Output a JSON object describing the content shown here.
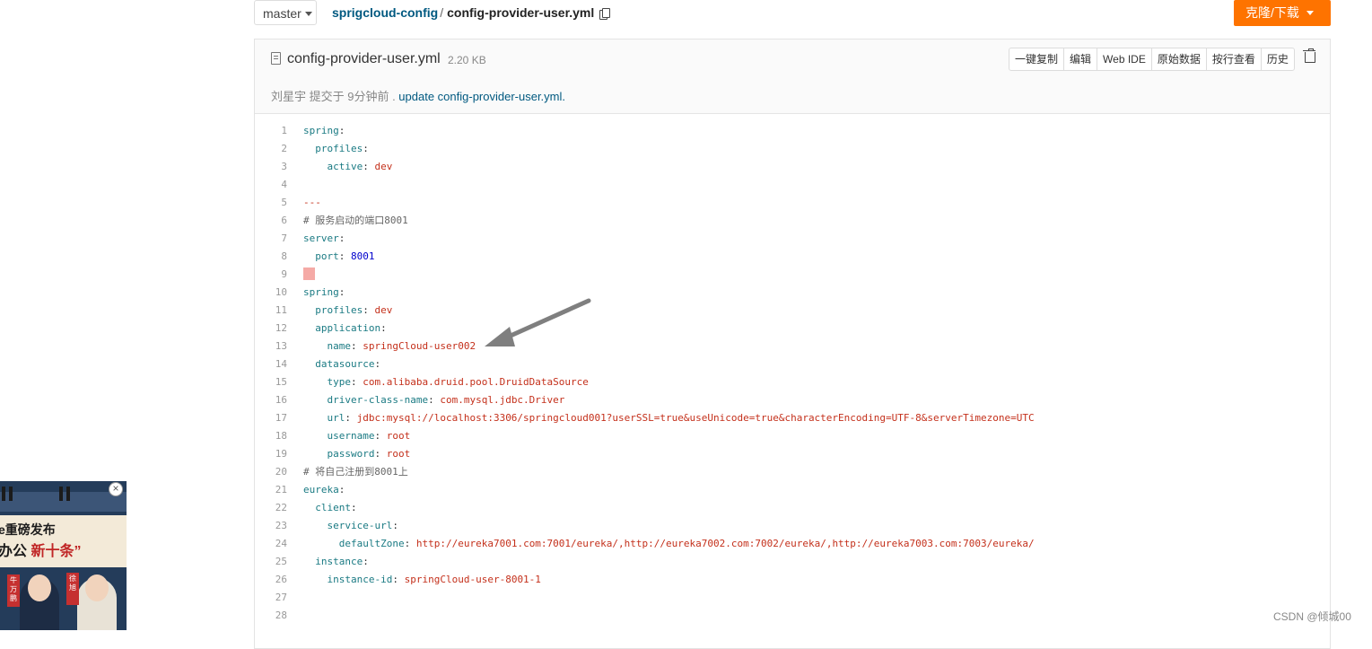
{
  "topbar": {
    "branch": "master",
    "repo": "sprigcloud-config",
    "separator": "/",
    "file_path": "config-provider-user.yml",
    "clone_button": "克隆/下载"
  },
  "file": {
    "name": "config-provider-user.yml",
    "size": "2.20 KB",
    "actions": [
      "一键复制",
      "编辑",
      "Web IDE",
      "原始数据",
      "按行查看",
      "历史"
    ],
    "commit_text": "刘星宇 提交于 9分钟前 . ",
    "commit_message": "update config-provider-user.yml."
  },
  "code_lines": [
    {
      "n": "1",
      "indent": "",
      "key": "spring",
      "sep": ":",
      "val": ""
    },
    {
      "n": "2",
      "indent": "  ",
      "key": "profiles",
      "sep": ":",
      "val": ""
    },
    {
      "n": "3",
      "indent": "    ",
      "key": "active",
      "sep": ": ",
      "val": "dev"
    },
    {
      "n": "4",
      "indent": "",
      "key": "",
      "sep": "",
      "val": ""
    },
    {
      "n": "5",
      "indent": "",
      "key": "",
      "sep": "",
      "val": "---"
    },
    {
      "n": "6",
      "indent": "",
      "key": "",
      "sep": "",
      "comment": "# 服务启动的端口8001"
    },
    {
      "n": "7",
      "indent": "",
      "key": "server",
      "sep": ":",
      "val": ""
    },
    {
      "n": "8",
      "indent": "  ",
      "key": "port",
      "sep": ": ",
      "num": "8001"
    },
    {
      "n": "9",
      "indent": "",
      "key": "",
      "sep": "",
      "err": true
    },
    {
      "n": "10",
      "indent": "",
      "key": "spring",
      "sep": ":",
      "val": ""
    },
    {
      "n": "11",
      "indent": "  ",
      "key": "profiles",
      "sep": ": ",
      "val": "dev"
    },
    {
      "n": "12",
      "indent": "  ",
      "key": "application",
      "sep": ":",
      "val": ""
    },
    {
      "n": "13",
      "indent": "    ",
      "key": "name",
      "sep": ": ",
      "val": "springCloud-user002"
    },
    {
      "n": "14",
      "indent": "  ",
      "key": "datasource",
      "sep": ":",
      "val": ""
    },
    {
      "n": "15",
      "indent": "    ",
      "key": "type",
      "sep": ": ",
      "val": "com.alibaba.druid.pool.DruidDataSource"
    },
    {
      "n": "16",
      "indent": "    ",
      "key": "driver-class-name",
      "sep": ": ",
      "val": "com.mysql.jdbc.Driver"
    },
    {
      "n": "17",
      "indent": "    ",
      "key": "url",
      "sep": ": ",
      "val": "jdbc:mysql://localhost:3306/springcloud001?userSSL=true&useUnicode=true&characterEncoding=UTF-8&serverTimezone=UTC"
    },
    {
      "n": "18",
      "indent": "    ",
      "key": "username",
      "sep": ": ",
      "val": "root"
    },
    {
      "n": "19",
      "indent": "    ",
      "key": "password",
      "sep": ": ",
      "val": "root"
    },
    {
      "n": "20",
      "indent": "",
      "key": "",
      "sep": "",
      "comment": "# 将自己注册到8001上"
    },
    {
      "n": "21",
      "indent": "",
      "key": "eureka",
      "sep": ":",
      "val": ""
    },
    {
      "n": "22",
      "indent": "  ",
      "key": "client",
      "sep": ":",
      "val": ""
    },
    {
      "n": "23",
      "indent": "    ",
      "key": "service-url",
      "sep": ":",
      "val": ""
    },
    {
      "n": "24",
      "indent": "      ",
      "key": "defaultZone",
      "sep": ": ",
      "val": "http://eureka7001.com:7001/eureka/,http://eureka7002.com:7002/eureka/,http://eureka7003.com:7003/eureka/"
    },
    {
      "n": "25",
      "indent": "  ",
      "key": "instance",
      "sep": ":",
      "val": ""
    },
    {
      "n": "26",
      "indent": "    ",
      "key": "instance-id",
      "sep": ": ",
      "val": "springCloud-user-8001-1"
    },
    {
      "n": "27",
      "indent": "",
      "key": "",
      "sep": "",
      "val": ""
    },
    {
      "n": "28",
      "indent": "",
      "key": "",
      "sep": "",
      "val": ""
    }
  ],
  "ad": {
    "line1": "e重磅发布",
    "line2_pre": "办公",
    "line2_hl": "新十条",
    "quote": "”",
    "tag_left": "牛万鹏",
    "tag_right": "徐旭",
    "close": "×"
  },
  "watermark": "CSDN @倾城00",
  "colors": {
    "accent_orange": "#fe7300",
    "link": "#005980",
    "yaml_key": "#1a7a83",
    "yaml_value": "#c4301b",
    "yaml_number": "#0000cc"
  }
}
